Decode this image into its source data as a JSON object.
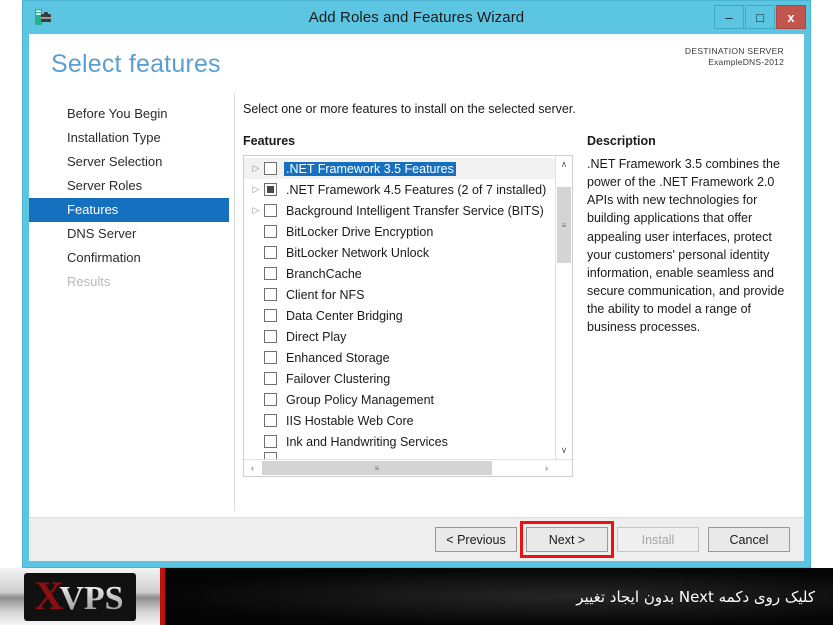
{
  "window": {
    "title": "Add Roles and Features Wizard",
    "icon": "server-manager-icon",
    "minimize_label": "–",
    "maximize_label": "□",
    "close_label": "x"
  },
  "header": {
    "page_title": "Select features",
    "destination_label": "DESTINATION SERVER",
    "destination_name": "ExampleDNS-2012"
  },
  "sidebar": {
    "items": [
      {
        "label": "Before You Begin",
        "state": "normal"
      },
      {
        "label": "Installation Type",
        "state": "normal"
      },
      {
        "label": "Server Selection",
        "state": "normal"
      },
      {
        "label": "Server Roles",
        "state": "normal"
      },
      {
        "label": "Features",
        "state": "active"
      },
      {
        "label": "DNS Server",
        "state": "normal"
      },
      {
        "label": "Confirmation",
        "state": "normal"
      },
      {
        "label": "Results",
        "state": "disabled"
      }
    ]
  },
  "content": {
    "instruction": "Select one or more features to install on the selected server.",
    "features_label": "Features",
    "description_label": "Description",
    "description_text": ".NET Framework 3.5 combines the power of the .NET Framework 2.0 APIs with new technologies for building applications that offer appealing user interfaces, protect your customers' personal identity information, enable seamless and secure communication, and provide the ability to model a range of business processes.",
    "features": [
      {
        "label": ".NET Framework 3.5 Features",
        "expandable": true,
        "checkbox": "unchecked",
        "selected": true
      },
      {
        "label": ".NET Framework 4.5 Features (2 of 7 installed)",
        "expandable": true,
        "checkbox": "partial",
        "selected": false
      },
      {
        "label": "Background Intelligent Transfer Service (BITS)",
        "expandable": true,
        "checkbox": "unchecked",
        "selected": false
      },
      {
        "label": "BitLocker Drive Encryption",
        "expandable": false,
        "checkbox": "unchecked",
        "selected": false
      },
      {
        "label": "BitLocker Network Unlock",
        "expandable": false,
        "checkbox": "unchecked",
        "selected": false
      },
      {
        "label": "BranchCache",
        "expandable": false,
        "checkbox": "unchecked",
        "selected": false
      },
      {
        "label": "Client for NFS",
        "expandable": false,
        "checkbox": "unchecked",
        "selected": false
      },
      {
        "label": "Data Center Bridging",
        "expandable": false,
        "checkbox": "unchecked",
        "selected": false
      },
      {
        "label": "Direct Play",
        "expandable": false,
        "checkbox": "unchecked",
        "selected": false
      },
      {
        "label": "Enhanced Storage",
        "expandable": false,
        "checkbox": "unchecked",
        "selected": false
      },
      {
        "label": "Failover Clustering",
        "expandable": false,
        "checkbox": "unchecked",
        "selected": false
      },
      {
        "label": "Group Policy Management",
        "expandable": false,
        "checkbox": "unchecked",
        "selected": false
      },
      {
        "label": "IIS Hostable Web Core",
        "expandable": false,
        "checkbox": "unchecked",
        "selected": false
      },
      {
        "label": "Ink and Handwriting Services",
        "expandable": false,
        "checkbox": "unchecked",
        "selected": false
      }
    ],
    "scroll": {
      "up_arrow": "∧",
      "down_arrow": "∨",
      "left_arrow": "‹",
      "right_arrow": "›",
      "grip": "≡"
    }
  },
  "footer": {
    "previous_label": "< Previous",
    "next_label": "Next >",
    "install_label": "Install",
    "cancel_label": "Cancel",
    "highlighted_button": "Next >",
    "highlight_color": "#ee1111"
  },
  "banner": {
    "logo_x": "X",
    "logo_vps": "VPS",
    "text": "کلیک روی دکمه Next بدون ایجاد تغییر"
  },
  "colors": {
    "window_frame": "#5bc5e2",
    "accent_blue": "#1570c0",
    "title_blue": "#5a9fd4",
    "close_red": "#c0564d"
  }
}
